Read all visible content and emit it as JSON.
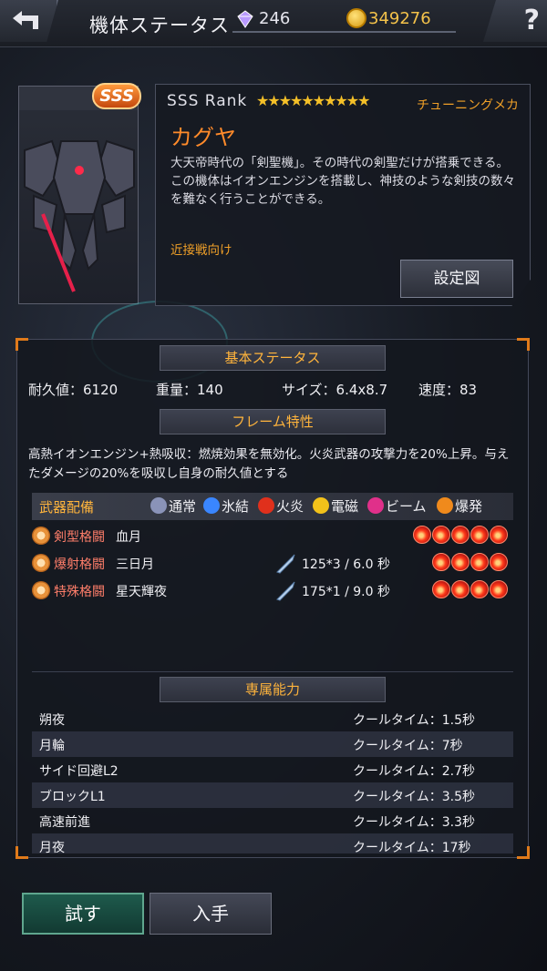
{
  "header": {
    "title": "機体ステータス",
    "gems": "246",
    "coins": "349276",
    "help_label": "?"
  },
  "mech": {
    "rank_badge": "SSS",
    "rank_text": "SSS Rank",
    "stars": "★★★★★★★★★★",
    "type": "チューニングメカ",
    "name": "カグヤ",
    "description": "大天帝時代の「剣聖機」。その時代の剣聖だけが搭乗できる。この機体はイオンエンジンを搭載し、神技のような剣技の数々を難なく行うことができる。",
    "combat_tag": "近接戦向け",
    "blueprint_label": "設定図"
  },
  "basic": {
    "header": "基本ステータス",
    "durability": "耐久値：6120",
    "weight": "重量：140",
    "size": "サイズ：6.4x8.7",
    "speed": "速度：83"
  },
  "frame": {
    "header": "フレーム特性",
    "description": "高熱イオンエンジン+熱吸収：燃焼効果を無効化。火炎武器の攻撃力を20%上昇。与えたダメージの20%を吸収し自身の耐久値とする"
  },
  "weapons": {
    "title": "武器配備",
    "legend": [
      {
        "label": "通常",
        "color": "#8a93b8"
      },
      {
        "label": "氷結",
        "color": "#3a86ff"
      },
      {
        "label": "火炎",
        "color": "#e0301c"
      },
      {
        "label": "電磁",
        "color": "#f2c21a"
      },
      {
        "label": "ビーム",
        "color": "#e0308a"
      },
      {
        "label": "爆発",
        "color": "#f08a1c"
      }
    ],
    "rows": [
      {
        "category": "剣型格闘",
        "name": "血月",
        "stat": "",
        "fire_count": 5
      },
      {
        "category": "爆射格闘",
        "name": "三日月",
        "stat": "125*3 / 6.0 秒",
        "fire_count": 4
      },
      {
        "category": "特殊格闘",
        "name": "星天輝夜",
        "stat": "175*1 / 9.0 秒",
        "fire_count": 4
      }
    ]
  },
  "abilities": {
    "header": "専属能力",
    "rows": [
      {
        "name": "朔夜",
        "cooldown": "クールタイム：1.5秒"
      },
      {
        "name": "月輪",
        "cooldown": "クールタイム：7秒"
      },
      {
        "name": "サイド回避L2",
        "cooldown": "クールタイム：2.7秒"
      },
      {
        "name": "ブロックL1",
        "cooldown": "クールタイム：3.5秒"
      },
      {
        "name": "高速前進",
        "cooldown": "クールタイム：3.3秒"
      },
      {
        "name": "月夜",
        "cooldown": "クールタイム：17秒"
      }
    ]
  },
  "actions": {
    "try_label": "試す",
    "acquire_label": "入手"
  }
}
